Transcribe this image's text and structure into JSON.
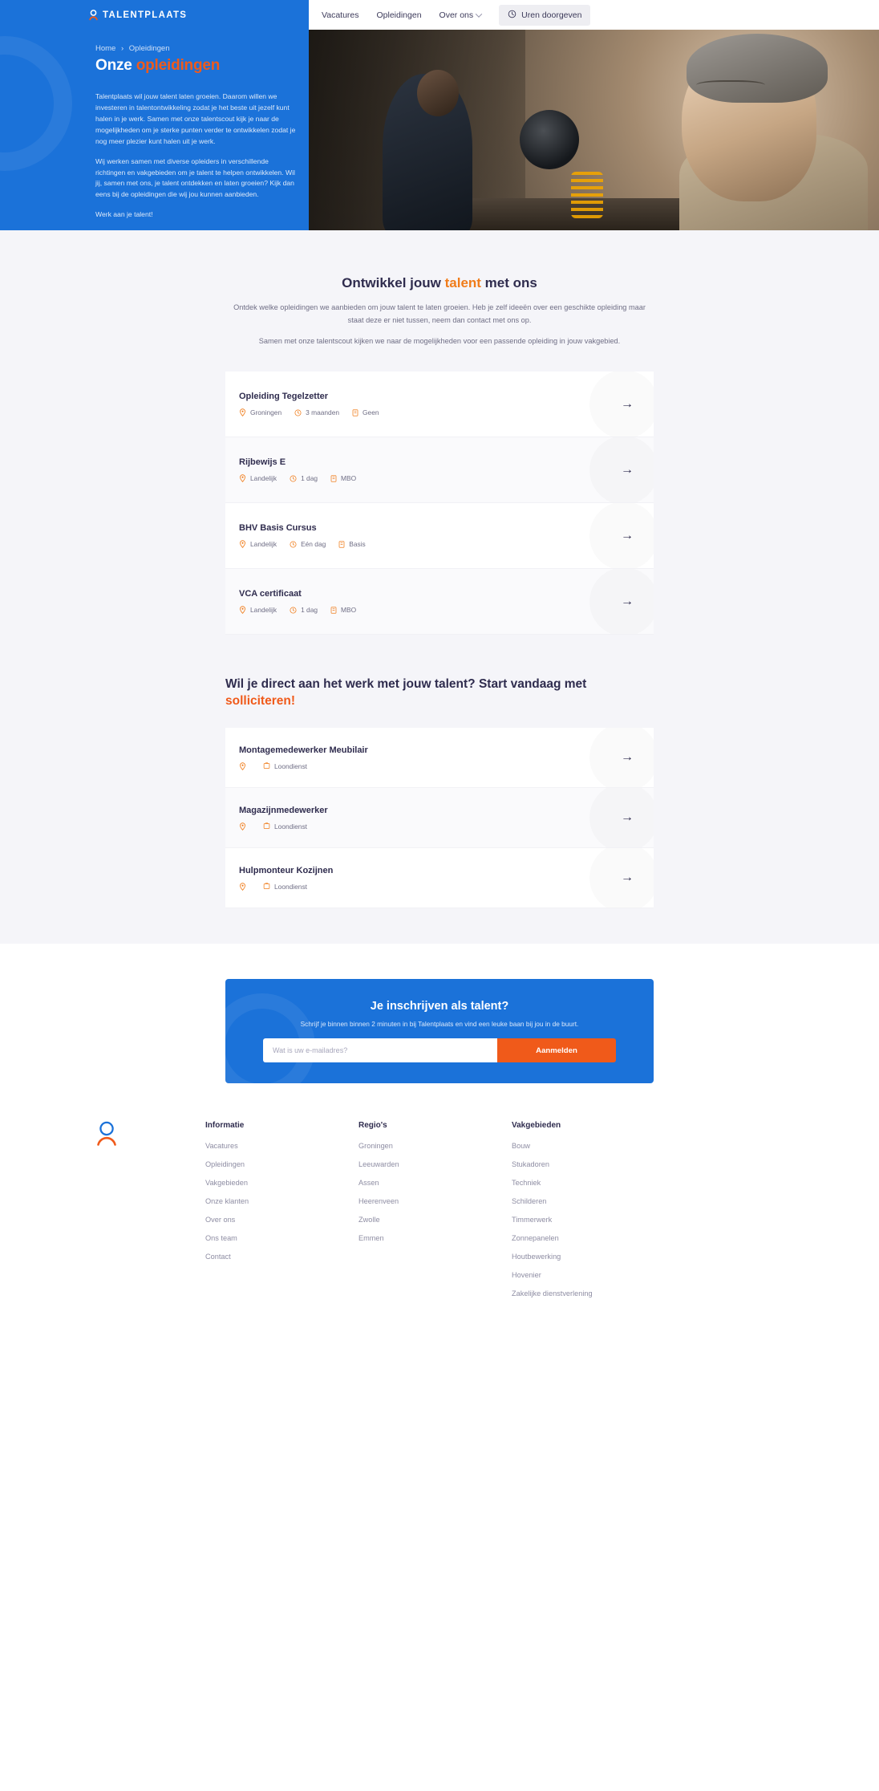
{
  "header": {
    "logo_text": "TALENTPLAATS",
    "nav": [
      {
        "label": "Vacatures",
        "has_chevron": false
      },
      {
        "label": "Opleidingen",
        "has_chevron": false
      },
      {
        "label": "Over ons",
        "has_chevron": true
      }
    ],
    "button": {
      "label": "Uren doorgeven",
      "icon": "clock-icon"
    }
  },
  "hero": {
    "breadcrumb": {
      "home": "Home",
      "separator": "›",
      "current": "Opleidingen"
    },
    "title_plain": "Onze ",
    "title_accent": "opleidingen",
    "paragraphs": [
      "Talentplaats wil jouw talent laten groeien. Daarom willen we investeren in talentontwikkeling zodat je het beste uit jezelf kunt halen in je werk. Samen met onze talentscout kijk je naar de mogelijkheden om je sterke punten verder te ontwikkelen zodat je nog meer plezier kunt halen uit je werk.",
      "Wij werken samen met diverse opleiders in verschillende richtingen en vakgebieden om je talent te helpen ontwikkelen. Wil jij, samen met ons, je talent ontdekken en laten groeien? Kijk dan eens bij de opleidingen die wij jou kunnen aanbieden.",
      "Werk aan je talent!"
    ]
  },
  "courses_section": {
    "title_before": "Ontwikkel jouw ",
    "title_accent": "talent",
    "title_after": " met ons",
    "subtitle_1": "Ontdek welke opleidingen we aanbieden om jouw talent te laten groeien. Heb je zelf ideeën over een geschikte opleiding maar staat deze er niet tussen, neem dan contact met ons op.",
    "subtitle_2": "Samen met onze talentscout kijken we naar de mogelijkheden voor een passende opleiding in jouw vakgebied.",
    "cards": [
      {
        "title": "Opleiding Tegelzetter",
        "location": "Groningen",
        "duration": "3 maanden",
        "level": "Geen",
        "arrow": "→"
      },
      {
        "title": "Rijbewijs E",
        "location": "Landelijk",
        "duration": "1 dag",
        "level": "MBO",
        "arrow": "→"
      },
      {
        "title": "BHV Basis Cursus",
        "location": "Landelijk",
        "duration": "Eén dag",
        "level": "Basis",
        "arrow": "→"
      },
      {
        "title": "VCA certificaat",
        "location": "Landelijk",
        "duration": "1 dag",
        "level": "MBO",
        "arrow": "→"
      }
    ]
  },
  "jobs_section": {
    "heading_before": "Wil je direct aan het werk met jouw talent? Start vandaag met ",
    "heading_accent": "solliciteren!",
    "cards": [
      {
        "title": "Montagemedewerker Meubilair",
        "location": "",
        "type": "Loondienst",
        "arrow": "→"
      },
      {
        "title": "Magazijnmedewerker",
        "location": "",
        "type": "Loondienst",
        "arrow": "→"
      },
      {
        "title": "Hulpmonteur Kozijnen",
        "location": "",
        "type": "Loondienst",
        "arrow": "→"
      }
    ]
  },
  "signup": {
    "title": "Je inschrijven als talent?",
    "subtitle": "Schrijf je binnen binnen 2 minuten in bij Talentplaats en vind een leuke baan bij jou in de buurt.",
    "placeholder": "Wat is uw e-mailadres?",
    "button": "Aanmelden"
  },
  "footer": {
    "columns": [
      {
        "heading": "Informatie",
        "links": [
          "Vacatures",
          "Opleidingen",
          "Vakgebieden",
          "Onze klanten",
          "Over ons",
          "Ons team",
          "Contact"
        ]
      },
      {
        "heading": "Regio's",
        "links": [
          "Groningen",
          "Leeuwarden",
          "Assen",
          "Heerenveen",
          "Zwolle",
          "Emmen"
        ]
      },
      {
        "heading": "Vakgebieden",
        "links": [
          "Bouw",
          "Stukadoren",
          "Techniek",
          "Schilderen",
          "Timmerwerk",
          "Zonnepanelen",
          "Houtbewerking",
          "Hovenier",
          "Zakelijke dienstverlening"
        ]
      }
    ]
  },
  "colors": {
    "brand_blue": "#1b72d9",
    "accent_orange": "#f05a1a",
    "title_orange": "#f07c1a",
    "dark_text": "#2f2c4e",
    "muted_text": "#8e8da3",
    "page_bg": "#f5f5f9"
  }
}
